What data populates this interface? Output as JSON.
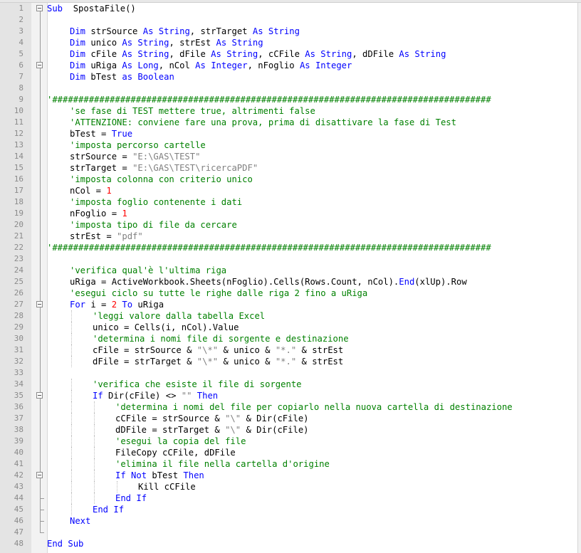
{
  "editor": {
    "lines": [
      {
        "n": "1",
        "indent": 0,
        "fold": "box",
        "tokens": [
          [
            "kw",
            "Sub"
          ],
          [
            "",
            "  SpostaFile()"
          ]
        ]
      },
      {
        "n": "2",
        "indent": 0,
        "fold": "bar",
        "tokens": []
      },
      {
        "n": "3",
        "indent": 1,
        "fold": "bar",
        "tokens": [
          [
            "kw",
            "Dim"
          ],
          [
            "",
            " strSource "
          ],
          [
            "kw",
            "As"
          ],
          [
            "",
            " "
          ],
          [
            "kw",
            "String"
          ],
          [
            "",
            ", strTarget "
          ],
          [
            "kw",
            "As"
          ],
          [
            "",
            " "
          ],
          [
            "kw",
            "String"
          ]
        ]
      },
      {
        "n": "4",
        "indent": 1,
        "fold": "bar",
        "tokens": [
          [
            "kw",
            "Dim"
          ],
          [
            "",
            " unico "
          ],
          [
            "kw",
            "As"
          ],
          [
            "",
            " "
          ],
          [
            "kw",
            "String"
          ],
          [
            "",
            ", strEst "
          ],
          [
            "kw",
            "As"
          ],
          [
            "",
            " "
          ],
          [
            "kw",
            "String"
          ]
        ]
      },
      {
        "n": "5",
        "indent": 1,
        "fold": "bar",
        "tokens": [
          [
            "kw",
            "Dim"
          ],
          [
            "",
            " cFile "
          ],
          [
            "kw",
            "As"
          ],
          [
            "",
            " "
          ],
          [
            "kw",
            "String"
          ],
          [
            "",
            ", dFile "
          ],
          [
            "kw",
            "As"
          ],
          [
            "",
            " "
          ],
          [
            "kw",
            "String"
          ],
          [
            "",
            ", cCFile "
          ],
          [
            "kw",
            "As"
          ],
          [
            "",
            " "
          ],
          [
            "kw",
            "String"
          ],
          [
            "",
            ", dDFile "
          ],
          [
            "kw",
            "As"
          ],
          [
            "",
            " "
          ],
          [
            "kw",
            "String"
          ]
        ]
      },
      {
        "n": "6",
        "indent": 1,
        "fold": "box",
        "tokens": [
          [
            "kw",
            "Dim"
          ],
          [
            "",
            " uRiga "
          ],
          [
            "kw",
            "As"
          ],
          [
            "",
            " "
          ],
          [
            "kw",
            "Long"
          ],
          [
            "",
            ", nCol "
          ],
          [
            "kw",
            "As"
          ],
          [
            "",
            " "
          ],
          [
            "kw",
            "Integer"
          ],
          [
            "",
            ", nFoglio "
          ],
          [
            "kw",
            "As"
          ],
          [
            "",
            " "
          ],
          [
            "kw",
            "Integer"
          ]
        ]
      },
      {
        "n": "7",
        "indent": 1,
        "fold": "bar",
        "tokens": [
          [
            "kw",
            "Dim"
          ],
          [
            "",
            " bTest "
          ],
          [
            "kw",
            "as"
          ],
          [
            "",
            " "
          ],
          [
            "kw",
            "Boolean"
          ]
        ]
      },
      {
        "n": "8",
        "indent": 0,
        "fold": "bar",
        "tokens": []
      },
      {
        "n": "9",
        "indent": 0,
        "fold": "bar",
        "tokens": [
          [
            "cm",
            "'####################################################################################"
          ]
        ]
      },
      {
        "n": "10",
        "indent": 1,
        "fold": "bar",
        "tokens": [
          [
            "cm",
            "'se fase di TEST mettere true, altrimenti false"
          ]
        ]
      },
      {
        "n": "11",
        "indent": 1,
        "fold": "bar",
        "tokens": [
          [
            "cm",
            "'ATTENZIONE: conviene fare una prova, prima di disattivare la fase di Test"
          ]
        ]
      },
      {
        "n": "12",
        "indent": 1,
        "fold": "bar",
        "tokens": [
          [
            "",
            "bTest = "
          ],
          [
            "kw",
            "True"
          ]
        ]
      },
      {
        "n": "13",
        "indent": 1,
        "fold": "bar",
        "tokens": [
          [
            "cm",
            "'imposta percorso cartelle"
          ]
        ]
      },
      {
        "n": "14",
        "indent": 1,
        "fold": "bar",
        "tokens": [
          [
            "",
            "strSource = "
          ],
          [
            "st",
            "\"E:\\GAS\\TEST\""
          ]
        ]
      },
      {
        "n": "15",
        "indent": 1,
        "fold": "bar",
        "tokens": [
          [
            "",
            "strTarget = "
          ],
          [
            "st",
            "\"E:\\GAS\\TEST\\ricercaPDF\""
          ]
        ]
      },
      {
        "n": "16",
        "indent": 1,
        "fold": "bar",
        "tokens": [
          [
            "cm",
            "'imposta colonna con criterio unico"
          ]
        ]
      },
      {
        "n": "17",
        "indent": 1,
        "fold": "bar",
        "tokens": [
          [
            "",
            "nCol = "
          ],
          [
            "nm",
            "1"
          ]
        ]
      },
      {
        "n": "18",
        "indent": 1,
        "fold": "bar",
        "tokens": [
          [
            "cm",
            "'imposta foglio contenente i dati"
          ]
        ]
      },
      {
        "n": "19",
        "indent": 1,
        "fold": "bar",
        "tokens": [
          [
            "",
            "nFoglio = "
          ],
          [
            "nm",
            "1"
          ]
        ]
      },
      {
        "n": "20",
        "indent": 1,
        "fold": "bar",
        "tokens": [
          [
            "cm",
            "'imposta tipo di file da cercare"
          ]
        ]
      },
      {
        "n": "21",
        "indent": 1,
        "fold": "bar",
        "tokens": [
          [
            "",
            "strEst = "
          ],
          [
            "st",
            "\"pdf\""
          ]
        ]
      },
      {
        "n": "22",
        "indent": 0,
        "fold": "bar",
        "tokens": [
          [
            "cm",
            "'####################################################################################"
          ]
        ]
      },
      {
        "n": "23",
        "indent": 0,
        "fold": "bar",
        "tokens": []
      },
      {
        "n": "24",
        "indent": 1,
        "fold": "bar",
        "tokens": [
          [
            "cm",
            "'verifica qual'è l'ultima riga"
          ]
        ]
      },
      {
        "n": "25",
        "indent": 1,
        "fold": "bar",
        "tokens": [
          [
            "",
            "uRiga = ActiveWorkbook.Sheets(nFoglio).Cells(Rows.Count, nCol)."
          ],
          [
            "kw",
            "End"
          ],
          [
            "",
            "(xlUp).Row"
          ]
        ]
      },
      {
        "n": "26",
        "indent": 1,
        "fold": "bar",
        "tokens": [
          [
            "cm",
            "'esegui ciclo su tutte le righe dalle riga 2 fino a uRiga"
          ]
        ]
      },
      {
        "n": "27",
        "indent": 1,
        "fold": "box",
        "tokens": [
          [
            "kw",
            "For"
          ],
          [
            "",
            " i = "
          ],
          [
            "nm",
            "2"
          ],
          [
            "",
            " "
          ],
          [
            "kw",
            "To"
          ],
          [
            "",
            " uRiga"
          ]
        ]
      },
      {
        "n": "28",
        "indent": 2,
        "fold": "bar",
        "tokens": [
          [
            "cm",
            "'leggi valore dalla tabella Excel"
          ]
        ]
      },
      {
        "n": "29",
        "indent": 2,
        "fold": "bar",
        "tokens": [
          [
            "",
            "unico = Cells(i, nCol).Value"
          ]
        ]
      },
      {
        "n": "30",
        "indent": 2,
        "fold": "bar",
        "tokens": [
          [
            "cm",
            "'determina i nomi file di sorgente e destinazione"
          ]
        ]
      },
      {
        "n": "31",
        "indent": 2,
        "fold": "bar",
        "tokens": [
          [
            "",
            "cFile = strSource & "
          ],
          [
            "st",
            "\"\\*\""
          ],
          [
            "",
            " & unico & "
          ],
          [
            "st",
            "\"*.\""
          ],
          [
            "",
            " & strEst"
          ]
        ]
      },
      {
        "n": "32",
        "indent": 2,
        "fold": "bar",
        "tokens": [
          [
            "",
            "dFile = strTarget & "
          ],
          [
            "st",
            "\"\\*\""
          ],
          [
            "",
            " & unico & "
          ],
          [
            "st",
            "\"*.\""
          ],
          [
            "",
            " & strEst"
          ]
        ]
      },
      {
        "n": "33",
        "indent": 0,
        "fold": "bar",
        "tokens": []
      },
      {
        "n": "34",
        "indent": 2,
        "fold": "bar",
        "tokens": [
          [
            "cm",
            "'verifica che esiste il file di sorgente"
          ]
        ]
      },
      {
        "n": "35",
        "indent": 2,
        "fold": "box",
        "tokens": [
          [
            "kw",
            "If"
          ],
          [
            "",
            " Dir(cFile) <> "
          ],
          [
            "st",
            "\"\""
          ],
          [
            "",
            " "
          ],
          [
            "kw",
            "Then"
          ]
        ]
      },
      {
        "n": "36",
        "indent": 3,
        "fold": "bar",
        "tokens": [
          [
            "cm",
            "'determina i nomi del file per copiarlo nella nuova cartella di destinazione"
          ]
        ]
      },
      {
        "n": "37",
        "indent": 3,
        "fold": "bar",
        "tokens": [
          [
            "",
            "cCFile = strSource & "
          ],
          [
            "st",
            "\"\\\""
          ],
          [
            "",
            " & Dir(cFile)"
          ]
        ]
      },
      {
        "n": "38",
        "indent": 3,
        "fold": "bar",
        "tokens": [
          [
            "",
            "dDFile = strTarget & "
          ],
          [
            "st",
            "\"\\\""
          ],
          [
            "",
            " & Dir(cFile)"
          ]
        ]
      },
      {
        "n": "39",
        "indent": 3,
        "fold": "bar",
        "tokens": [
          [
            "cm",
            "'esegui la copia del file"
          ]
        ]
      },
      {
        "n": "40",
        "indent": 3,
        "fold": "bar",
        "tokens": [
          [
            "",
            "FileCopy cCFile, dDFile"
          ]
        ]
      },
      {
        "n": "41",
        "indent": 3,
        "fold": "bar",
        "tokens": [
          [
            "cm",
            "'elimina il file nella cartella d'origine"
          ]
        ]
      },
      {
        "n": "42",
        "indent": 3,
        "fold": "box",
        "tokens": [
          [
            "kw",
            "If"
          ],
          [
            "",
            " "
          ],
          [
            "kw",
            "Not"
          ],
          [
            "",
            " bTest "
          ],
          [
            "kw",
            "Then"
          ]
        ]
      },
      {
        "n": "43",
        "indent": 4,
        "fold": "bar",
        "tokens": [
          [
            "",
            "Kill cCFile"
          ]
        ]
      },
      {
        "n": "44",
        "indent": 3,
        "fold": "tick",
        "tokens": [
          [
            "kw",
            "End"
          ],
          [
            "",
            " "
          ],
          [
            "kw",
            "If"
          ]
        ]
      },
      {
        "n": "45",
        "indent": 2,
        "fold": "tick",
        "tokens": [
          [
            "kw",
            "End"
          ],
          [
            "",
            " "
          ],
          [
            "kw",
            "If"
          ]
        ]
      },
      {
        "n": "46",
        "indent": 1,
        "fold": "tick",
        "tokens": [
          [
            "kw",
            "Next"
          ]
        ]
      },
      {
        "n": "47",
        "indent": 0,
        "fold": "tick",
        "tokens": []
      },
      {
        "n": "48",
        "indent": 0,
        "fold": "none",
        "tokens": [
          [
            "kw",
            "End"
          ],
          [
            "",
            " "
          ],
          [
            "kw",
            "Sub"
          ]
        ]
      }
    ]
  }
}
